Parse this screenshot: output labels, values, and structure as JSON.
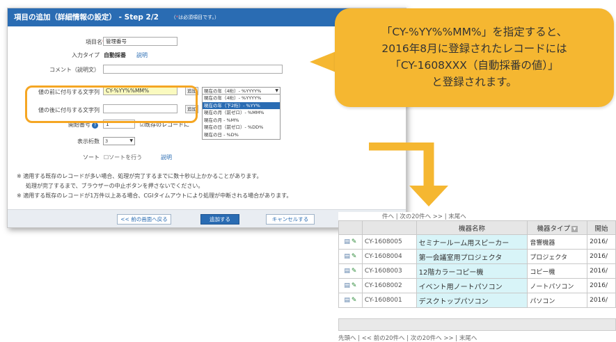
{
  "dialog": {
    "title": "項目の追加（詳細情報の設定） - Step 2/2",
    "required_note_star": "*",
    "required_note": "は必須項目です。）",
    "item_name_label": "項目名",
    "item_name_value": "管理番号",
    "input_type_label": "入力タイプ",
    "input_type_value": "自動採番",
    "help_link": "説明",
    "comment_label": "コメント（説明文）",
    "prefix_label": "値の前に付与する文字列",
    "prefix_value": "CY-%YY%%MM%",
    "suffix_label": "値の後に付与する文字列",
    "suffix_value": "",
    "add_button": "追加",
    "select_value": "現在の年（4桁）- %YYYY%",
    "dropdown_options": [
      "現在の年（4桁）- %YYYY%",
      "現在の年（下2桁）- %YY%",
      "現在の月（前ゼロ）- %MM%",
      "現在の月 - %M%",
      "現在の日（前ゼロ）- %DD%",
      "現在の日 - %D%"
    ],
    "dropdown_selected_index": 1,
    "start_number_label": "開始番号",
    "start_number_value": "1",
    "existing_record_label": "既存のレコードに",
    "digits_label": "表示桁数",
    "digits_value": "3",
    "sort_label": "ソート",
    "sort_checkbox_label": "ソートを行う",
    "notes": [
      "※ 適用する既存のレコードが多い場合、処理が完了するまでに数十秒以上かかることがあります。",
      "処理が完了するまで、ブラウザーの中止ボタンを押さないでください。",
      "※ 適用する既存のレコードが1万件以上ある場合、CGIタイムアウトにより処理が中断される場合があります。"
    ],
    "back_button": "<< 前の画面へ戻る",
    "submit_button": "追加する",
    "cancel_button": "キャンセルする"
  },
  "callout": {
    "lines": [
      "「CY-%YY%%MM%」を指定すると、",
      "2016年8月に登録されたレコードには",
      "「CY-1608XXX（自動採番の値）」",
      "と登録されます。"
    ]
  },
  "table": {
    "pager_top": "件へ | 次の20件へ >> | 末尾へ",
    "pager_bottom": "先頭へ | << 前の20件へ | 次の20件へ >> | 末尾へ",
    "headers": [
      "",
      "",
      "機器名称",
      "機器タイプ",
      "開始"
    ],
    "rows": [
      {
        "code": "CY-1608005",
        "name": "セミナールーム用スピーカー",
        "type": "音響機器",
        "date": "2016/"
      },
      {
        "code": "CY-1608004",
        "name": "第一会議室用プロジェクタ",
        "type": "プロジェクタ",
        "date": "2016/"
      },
      {
        "code": "CY-1608003",
        "name": "12階カラーコピー機",
        "type": "コピー機",
        "date": "2016/"
      },
      {
        "code": "CY-1608002",
        "name": "イベント用ノートパソコン",
        "type": "ノートパソコン",
        "date": "2016/"
      },
      {
        "code": "CY-1608001",
        "name": "デスクトップパソコン",
        "type": "パソコン",
        "date": "2016/"
      }
    ]
  },
  "colors": {
    "header_blue": "#2a6cb3",
    "callout_orange": "#f5b731",
    "highlight_ring": "#f5a623",
    "name_cell": "#d8f4f8"
  }
}
